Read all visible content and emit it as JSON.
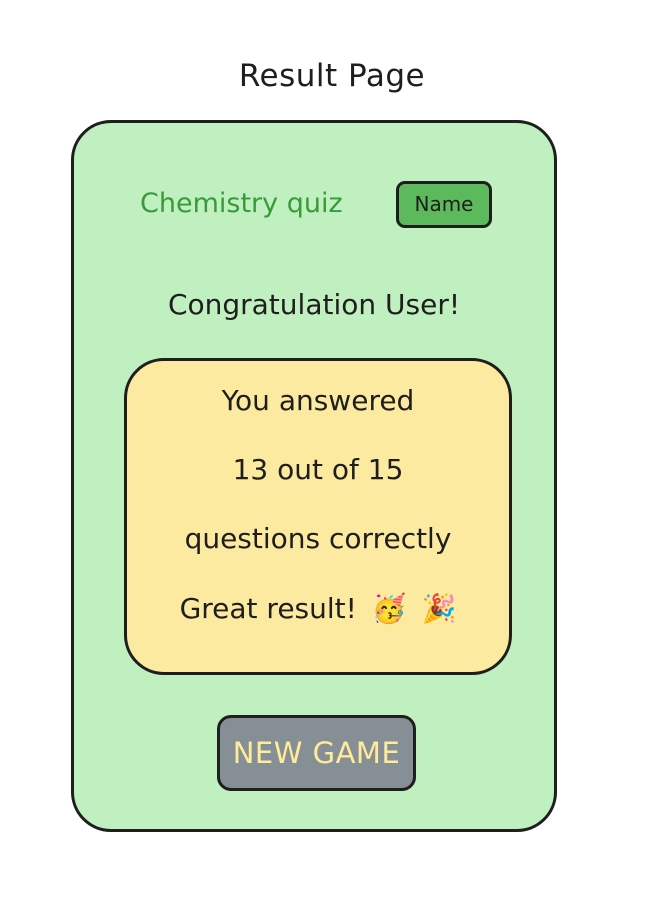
{
  "page": {
    "title": "Result Page"
  },
  "header": {
    "quiz_title": "Chemistry quiz",
    "name_button_label": "Name"
  },
  "main": {
    "congratulation": "Congratulation User!",
    "result": {
      "line1": "You answered",
      "line2": "13 out of 15",
      "line3": "questions correctly",
      "line4": "Great result!",
      "emoji1": "🥳",
      "emoji2": "🎉"
    },
    "new_game_label": "NEW GAME"
  },
  "colors": {
    "card_background": "#c0f0c0",
    "quiz_title": "#3a9a3a",
    "name_button": "#5cba5c",
    "result_box": "#fceaa0",
    "new_game_button": "#868e96",
    "new_game_text": "#ffec99",
    "outline": "#1e1e1e"
  }
}
